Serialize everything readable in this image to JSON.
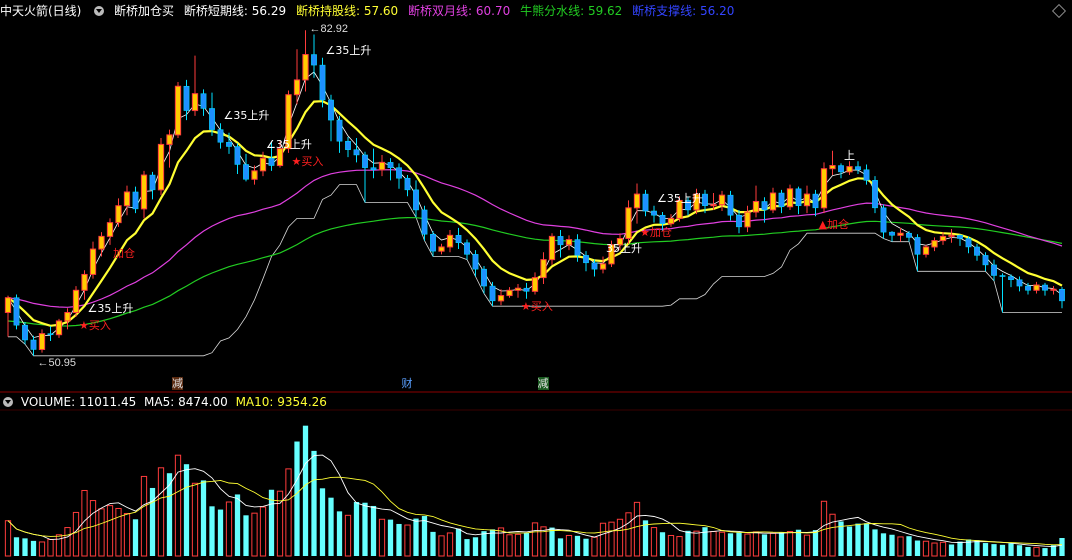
{
  "header": {
    "title": "中天火箭(日线)",
    "indicator_name": "断桥加仓买",
    "short_label": "断桥短期线:",
    "short_value": "56.29",
    "hold_label": "断桥持股线:",
    "hold_value": "57.60",
    "month_label": "断桥双月线:",
    "month_value": "60.70",
    "bull_label": "牛熊分水线:",
    "bull_value": "59.62",
    "support_label": "断桥支撑线:",
    "support_value": "56.20"
  },
  "price_panel": {
    "high_label": "82.92",
    "low_label": "50.95",
    "ticks": [
      "←"
    ],
    "signals": [
      {
        "text": "★买入",
        "color": "#ff2020"
      },
      {
        "text": "∠35上升",
        "color": "#ffffff"
      },
      {
        "text": "加仓",
        "color": "#ff2020"
      },
      {
        "text": "∠35上升",
        "color": "#ffffff"
      },
      {
        "text": "∠35上升",
        "color": "#ffffff"
      },
      {
        "text": "★买入",
        "color": "#ff2020"
      },
      {
        "text": "∠35上升",
        "color": "#ffffff"
      },
      {
        "text": "★买入",
        "color": "#ff2020"
      },
      {
        "text": "35上升",
        "color": "#ffffff"
      },
      {
        "text": "★加仓",
        "color": "#ff2020"
      },
      {
        "text": "∠35上升",
        "color": "#ffffff"
      },
      {
        "text": "▲加仓",
        "color": "#ff2020"
      },
      {
        "text": "上",
        "color": "#ffffff"
      }
    ],
    "event_tags": [
      {
        "text": "减",
        "color": "#e0e0e0",
        "bg": "#5a2a10"
      },
      {
        "text": "财",
        "color": "#5aa0ff",
        "bg": "transparent"
      },
      {
        "text": "减",
        "color": "#e0e0e0",
        "bg": "#1a5a20"
      }
    ]
  },
  "volume_header": {
    "label": "VOLUME:",
    "value": "11011.45",
    "ma5_label": "MA5:",
    "ma5_value": "8474.00",
    "ma10_label": "MA10:",
    "ma10_value": "9354.26"
  },
  "colors": {
    "up": "#ff3c3c",
    "down": "#00e0ff",
    "yellow": "#ffff33",
    "magenta": "#e040e0",
    "green": "#22cc22",
    "white": "#ffffff"
  },
  "chart_data": {
    "type": "candlestick",
    "price_range": [
      50.95,
      82.92
    ],
    "candles": [
      [
        56.2,
        57.6,
        53.9,
        57.8
      ],
      [
        57.6,
        55.0,
        54.6,
        57.9
      ],
      [
        55.0,
        53.6,
        53.2,
        55.3
      ],
      [
        53.6,
        52.7,
        52.1,
        54.0
      ],
      [
        52.7,
        54.2,
        52.4,
        54.6
      ],
      [
        54.2,
        54.1,
        53.5,
        54.9
      ],
      [
        54.1,
        55.4,
        53.8,
        55.6
      ],
      [
        55.4,
        56.2,
        54.6,
        56.6
      ],
      [
        56.2,
        58.3,
        55.8,
        58.7
      ],
      [
        58.3,
        59.8,
        57.4,
        60.2
      ],
      [
        59.8,
        62.2,
        59.4,
        62.9
      ],
      [
        62.2,
        63.4,
        61.5,
        63.8
      ],
      [
        63.4,
        64.7,
        62.6,
        65.1
      ],
      [
        64.7,
        66.3,
        64.3,
        67.0
      ],
      [
        66.3,
        67.6,
        65.4,
        68.2
      ],
      [
        67.6,
        66.0,
        65.6,
        68.1
      ],
      [
        66.0,
        69.2,
        65.1,
        69.6
      ],
      [
        69.2,
        67.8,
        66.9,
        69.5
      ],
      [
        67.8,
        72.1,
        67.3,
        72.7
      ],
      [
        72.1,
        73.0,
        69.9,
        73.5
      ],
      [
        73.0,
        77.6,
        72.7,
        78.0
      ],
      [
        77.6,
        75.3,
        74.4,
        78.2
      ],
      [
        75.3,
        76.9,
        74.8,
        80.5
      ],
      [
        76.9,
        75.5,
        74.8,
        77.3
      ],
      [
        75.5,
        73.5,
        72.9,
        77.0
      ],
      [
        73.5,
        72.3,
        71.7,
        74.1
      ],
      [
        72.3,
        71.9,
        71.2,
        73.2
      ],
      [
        71.9,
        70.2,
        69.3,
        72.2
      ],
      [
        70.2,
        68.8,
        68.6,
        71.2
      ],
      [
        68.8,
        69.6,
        68.3,
        70.1
      ],
      [
        69.6,
        70.8,
        69.1,
        71.4
      ],
      [
        70.8,
        70.1,
        69.6,
        72.3
      ],
      [
        70.1,
        71.7,
        69.9,
        72.4
      ],
      [
        71.7,
        76.8,
        71.3,
        77.2
      ],
      [
        76.8,
        78.2,
        75.9,
        81.1
      ],
      [
        78.2,
        80.6,
        77.1,
        82.9
      ],
      [
        80.6,
        79.6,
        78.4,
        82.5
      ],
      [
        79.6,
        76.3,
        75.6,
        80.3
      ],
      [
        76.3,
        74.4,
        72.4,
        76.8
      ],
      [
        74.4,
        72.4,
        71.3,
        74.8
      ],
      [
        72.4,
        71.6,
        70.9,
        72.8
      ],
      [
        71.6,
        71.1,
        70.4,
        72.7
      ],
      [
        71.1,
        69.9,
        66.6,
        71.4
      ],
      [
        69.9,
        69.7,
        68.9,
        71.7
      ],
      [
        69.7,
        70.4,
        69.1,
        71.1
      ],
      [
        70.4,
        69.9,
        68.7,
        70.8
      ],
      [
        69.9,
        68.9,
        67.9,
        70.3
      ],
      [
        68.9,
        67.8,
        67.2,
        69.2
      ],
      [
        67.8,
        65.9,
        65.2,
        68.7
      ],
      [
        65.9,
        63.6,
        63.0,
        66.3
      ],
      [
        63.6,
        62.0,
        61.5,
        63.9
      ],
      [
        62.0,
        62.4,
        61.7,
        62.7
      ],
      [
        62.4,
        63.5,
        61.9,
        64.0
      ],
      [
        63.5,
        62.8,
        62.2,
        64.2
      ],
      [
        62.8,
        61.7,
        61.2,
        63.1
      ],
      [
        61.7,
        60.3,
        59.6,
        62.1
      ],
      [
        60.3,
        58.7,
        58.0,
        60.6
      ],
      [
        58.7,
        57.3,
        56.8,
        59.1
      ],
      [
        57.3,
        57.8,
        56.9,
        58.4
      ],
      [
        57.8,
        58.3,
        57.6,
        58.6
      ],
      [
        58.3,
        58.5,
        57.6,
        58.9
      ],
      [
        58.5,
        58.2,
        57.5,
        59.0
      ],
      [
        58.2,
        59.5,
        57.9,
        60.0
      ],
      [
        59.5,
        61.2,
        58.9,
        61.9
      ],
      [
        61.2,
        63.4,
        60.7,
        63.7
      ],
      [
        63.4,
        62.6,
        61.4,
        64.0
      ],
      [
        62.6,
        63.1,
        62.1,
        63.5
      ],
      [
        63.1,
        61.6,
        61.0,
        63.6
      ],
      [
        61.6,
        60.9,
        60.1,
        62.0
      ],
      [
        60.9,
        60.3,
        59.6,
        61.2
      ],
      [
        60.3,
        60.8,
        59.9,
        61.5
      ],
      [
        60.8,
        62.6,
        60.5,
        63.0
      ],
      [
        62.6,
        63.2,
        62.1,
        63.7
      ],
      [
        63.2,
        66.1,
        62.7,
        66.8
      ],
      [
        66.1,
        67.4,
        64.6,
        68.4
      ],
      [
        67.4,
        65.8,
        65.3,
        67.8
      ],
      [
        65.8,
        65.4,
        64.7,
        66.3
      ],
      [
        65.4,
        64.6,
        63.9,
        65.7
      ],
      [
        64.6,
        65.1,
        64.3,
        65.5
      ],
      [
        65.1,
        66.8,
        64.8,
        67.2
      ],
      [
        66.8,
        65.9,
        65.4,
        67.1
      ],
      [
        65.9,
        67.4,
        65.5,
        67.9
      ],
      [
        67.4,
        66.3,
        65.6,
        67.8
      ],
      [
        66.3,
        66.4,
        65.9,
        67.5
      ],
      [
        66.4,
        67.3,
        65.8,
        67.7
      ],
      [
        67.3,
        65.4,
        64.9,
        67.7
      ],
      [
        65.4,
        64.3,
        63.7,
        65.9
      ],
      [
        64.3,
        65.7,
        63.8,
        66.3
      ],
      [
        65.7,
        66.7,
        65.2,
        68.2
      ],
      [
        66.7,
        65.9,
        64.7,
        67.1
      ],
      [
        65.9,
        67.5,
        65.6,
        68.0
      ],
      [
        67.5,
        66.2,
        65.6,
        67.8
      ],
      [
        66.2,
        67.9,
        65.9,
        68.3
      ],
      [
        67.9,
        66.3,
        65.5,
        68.1
      ],
      [
        66.3,
        67.4,
        65.6,
        68.2
      ],
      [
        67.4,
        66.1,
        65.3,
        67.8
      ],
      [
        66.1,
        69.8,
        65.6,
        70.4
      ],
      [
        69.8,
        70.1,
        69.2,
        71.5
      ],
      [
        70.1,
        69.5,
        68.9,
        70.3
      ],
      [
        69.5,
        70.0,
        69.2,
        70.5
      ],
      [
        70.0,
        69.7,
        69.3,
        70.5
      ],
      [
        69.7,
        68.7,
        68.3,
        70.2
      ],
      [
        68.7,
        66.1,
        65.6,
        69.1
      ],
      [
        66.1,
        63.8,
        63.2,
        66.4
      ],
      [
        63.8,
        63.5,
        62.9,
        63.9
      ],
      [
        63.5,
        63.7,
        62.9,
        64.2
      ],
      [
        63.7,
        63.3,
        62.9,
        63.9
      ],
      [
        63.3,
        61.7,
        60.1,
        63.6
      ],
      [
        61.7,
        62.4,
        61.4,
        62.6
      ],
      [
        62.4,
        63.0,
        62.0,
        63.3
      ],
      [
        63.0,
        63.4,
        62.6,
        63.8
      ],
      [
        63.4,
        63.5,
        62.8,
        64.1
      ],
      [
        63.5,
        63.2,
        62.5,
        63.6
      ],
      [
        63.2,
        62.4,
        61.8,
        63.4
      ],
      [
        62.4,
        61.6,
        61.1,
        62.7
      ],
      [
        61.6,
        60.7,
        60.1,
        61.9
      ],
      [
        60.7,
        59.7,
        59.2,
        61.2
      ],
      [
        59.7,
        59.6,
        56.2,
        59.9
      ],
      [
        59.6,
        59.3,
        58.6,
        59.8
      ],
      [
        59.3,
        58.7,
        58.2,
        59.6
      ],
      [
        58.7,
        58.3,
        57.9,
        59.0
      ],
      [
        58.3,
        58.8,
        58.0,
        59.1
      ],
      [
        58.8,
        58.3,
        57.8,
        59.0
      ],
      [
        58.3,
        58.4,
        57.9,
        58.7
      ],
      [
        58.4,
        57.3,
        56.6,
        58.6
      ]
    ],
    "volume": [
      {
        "v": 9.8,
        "up": true
      },
      {
        "v": 5.2,
        "up": false
      },
      {
        "v": 4.9,
        "up": false
      },
      {
        "v": 4.2,
        "up": false
      },
      {
        "v": 3.9,
        "up": true
      },
      {
        "v": 4.6,
        "up": true
      },
      {
        "v": 5.9,
        "up": true
      },
      {
        "v": 7.9,
        "up": true
      },
      {
        "v": 12.1,
        "up": true
      },
      {
        "v": 18.2,
        "up": true
      },
      {
        "v": 15.4,
        "up": true
      },
      {
        "v": 13.1,
        "up": true
      },
      {
        "v": 14.0,
        "up": true
      },
      {
        "v": 13.2,
        "up": true
      },
      {
        "v": 11.8,
        "up": true
      },
      {
        "v": 10.2,
        "up": false
      },
      {
        "v": 22.1,
        "up": true
      },
      {
        "v": 18.9,
        "up": false
      },
      {
        "v": 24.5,
        "up": true
      },
      {
        "v": 23.0,
        "up": false
      },
      {
        "v": 28.0,
        "up": true
      },
      {
        "v": 25.5,
        "up": false
      },
      {
        "v": 20.2,
        "up": true
      },
      {
        "v": 21.0,
        "up": false
      },
      {
        "v": 13.8,
        "up": false
      },
      {
        "v": 12.9,
        "up": false
      },
      {
        "v": 15.0,
        "up": true
      },
      {
        "v": 17.1,
        "up": false
      },
      {
        "v": 11.3,
        "up": false
      },
      {
        "v": 11.9,
        "up": true
      },
      {
        "v": 13.6,
        "up": true
      },
      {
        "v": 18.4,
        "up": false
      },
      {
        "v": 18.0,
        "up": true
      },
      {
        "v": 24.2,
        "up": true
      },
      {
        "v": 31.8,
        "up": false
      },
      {
        "v": 36.2,
        "up": false
      },
      {
        "v": 29.2,
        "up": false
      },
      {
        "v": 18.8,
        "up": false
      },
      {
        "v": 16.2,
        "up": false
      },
      {
        "v": 12.4,
        "up": false
      },
      {
        "v": 11.3,
        "up": true
      },
      {
        "v": 15.0,
        "up": false
      },
      {
        "v": 14.8,
        "up": false
      },
      {
        "v": 13.9,
        "up": false
      },
      {
        "v": 10.2,
        "up": true
      },
      {
        "v": 10.1,
        "up": false
      },
      {
        "v": 8.9,
        "up": false
      },
      {
        "v": 8.6,
        "up": true
      },
      {
        "v": 10.4,
        "up": false
      },
      {
        "v": 11.1,
        "up": false
      },
      {
        "v": 6.7,
        "up": false
      },
      {
        "v": 5.6,
        "up": true
      },
      {
        "v": 6.4,
        "up": true
      },
      {
        "v": 7.6,
        "up": false
      },
      {
        "v": 4.7,
        "up": false
      },
      {
        "v": 5.2,
        "up": false
      },
      {
        "v": 6.9,
        "up": false
      },
      {
        "v": 7.4,
        "up": false
      },
      {
        "v": 7.8,
        "up": true
      },
      {
        "v": 5.9,
        "up": true
      },
      {
        "v": 6.0,
        "up": true
      },
      {
        "v": 6.4,
        "up": false
      },
      {
        "v": 9.2,
        "up": true
      },
      {
        "v": 8.1,
        "up": true
      },
      {
        "v": 7.9,
        "up": false
      },
      {
        "v": 4.9,
        "up": false
      },
      {
        "v": 5.7,
        "up": true
      },
      {
        "v": 5.6,
        "up": false
      },
      {
        "v": 4.8,
        "up": false
      },
      {
        "v": 5.2,
        "up": true
      },
      {
        "v": 9.1,
        "up": true
      },
      {
        "v": 9.4,
        "up": true
      },
      {
        "v": 10.2,
        "up": true
      },
      {
        "v": 12.0,
        "up": true
      },
      {
        "v": 14.9,
        "up": true
      },
      {
        "v": 9.9,
        "up": false
      },
      {
        "v": 7.9,
        "up": true
      },
      {
        "v": 6.6,
        "up": false
      },
      {
        "v": 5.7,
        "up": true
      },
      {
        "v": 5.4,
        "up": true
      },
      {
        "v": 7.0,
        "up": false
      },
      {
        "v": 6.9,
        "up": true
      },
      {
        "v": 8.0,
        "up": false
      },
      {
        "v": 6.8,
        "up": true
      },
      {
        "v": 6.6,
        "up": true
      },
      {
        "v": 6.3,
        "up": false
      },
      {
        "v": 6.5,
        "up": false
      },
      {
        "v": 6.1,
        "up": true
      },
      {
        "v": 6.7,
        "up": true
      },
      {
        "v": 6.0,
        "up": false
      },
      {
        "v": 6.3,
        "up": true
      },
      {
        "v": 6.5,
        "up": false
      },
      {
        "v": 6.8,
        "up": true
      },
      {
        "v": 7.3,
        "up": false
      },
      {
        "v": 5.8,
        "up": true
      },
      {
        "v": 7.2,
        "up": false
      },
      {
        "v": 15.2,
        "up": true
      },
      {
        "v": 11.6,
        "up": true
      },
      {
        "v": 9.6,
        "up": false
      },
      {
        "v": 8.2,
        "up": false
      },
      {
        "v": 9.0,
        "up": false
      },
      {
        "v": 9.1,
        "up": false
      },
      {
        "v": 7.4,
        "up": false
      },
      {
        "v": 6.3,
        "up": false
      },
      {
        "v": 5.9,
        "up": false
      },
      {
        "v": 5.3,
        "up": true
      },
      {
        "v": 5.5,
        "up": false
      },
      {
        "v": 4.3,
        "up": false
      },
      {
        "v": 4.1,
        "up": true
      },
      {
        "v": 3.6,
        "up": true
      },
      {
        "v": 3.8,
        "up": true
      },
      {
        "v": 3.2,
        "up": false
      },
      {
        "v": 4.0,
        "up": false
      },
      {
        "v": 4.6,
        "up": false
      },
      {
        "v": 4.4,
        "up": false
      },
      {
        "v": 3.6,
        "up": false
      },
      {
        "v": 3.3,
        "up": false
      },
      {
        "v": 3.1,
        "up": false
      },
      {
        "v": 3.5,
        "up": false
      },
      {
        "v": 3.0,
        "up": false
      },
      {
        "v": 2.5,
        "up": false
      },
      {
        "v": 2.4,
        "up": true
      },
      {
        "v": 2.2,
        "up": false
      },
      {
        "v": 3.0,
        "up": false
      },
      {
        "v": 5.0,
        "up": false
      }
    ],
    "volume_range": [
      0,
      40
    ]
  }
}
